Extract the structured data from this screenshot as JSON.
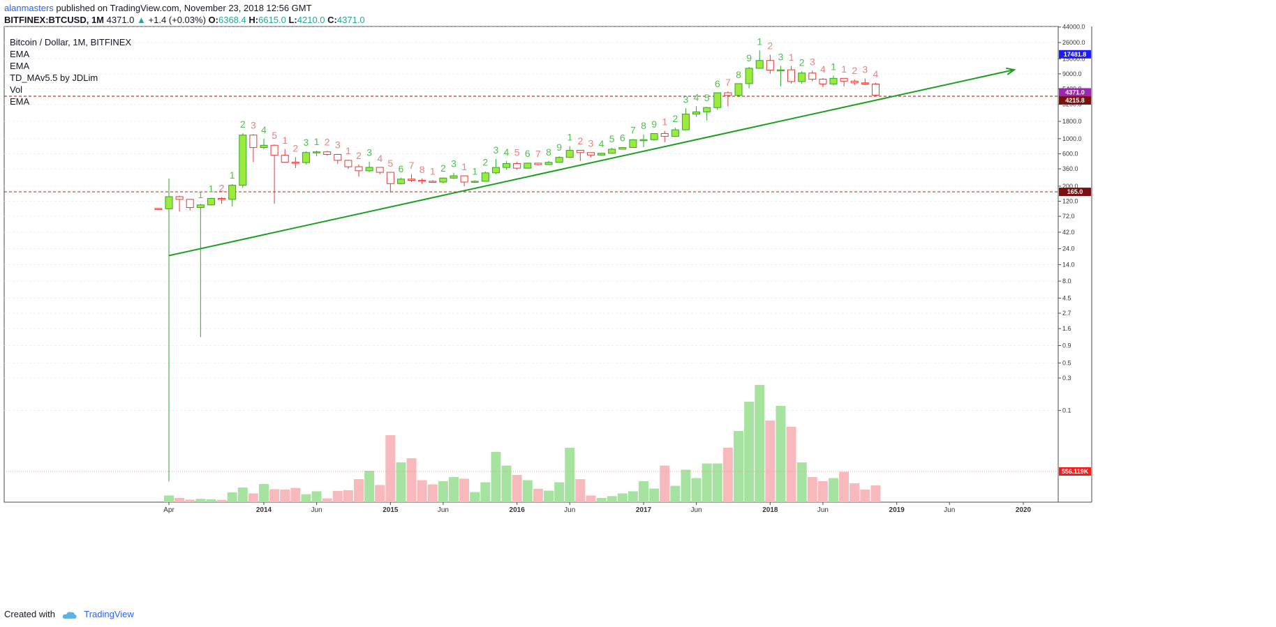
{
  "header": {
    "author": "alanmasters",
    "published_text": " published on TradingView.com, November 23, 2018 12:56 GMT",
    "symbol": "BITFINEX:BTCUSD, 1M",
    "last": "4371.0",
    "change": "+1.4 (+0.03%)",
    "o_label": "O:",
    "o_value": "6368.4",
    "h_label": "H:",
    "h_value": "6615.0",
    "l_label": "L:",
    "l_value": "4210.0",
    "c_label": "C:",
    "c_value": "4371.0"
  },
  "legend": {
    "title": "Bitcoin / Dollar, 1M, BITFINEX",
    "items": [
      "EMA",
      "EMA",
      "TD_MAv5.5 by JDLim",
      "Vol",
      "EMA"
    ]
  },
  "footer": {
    "created_with": "Created with",
    "brand": "TradingView"
  },
  "colors": {
    "up": "#9bea3c",
    "down": "#e53935",
    "vol_up": "#a6e3a1",
    "vol_down": "#f8b9bd",
    "trend": "#1e9e1e",
    "level": "#c0392b",
    "grid": "#e6f2f7"
  },
  "chart_data": {
    "type": "candlestick",
    "y_scale": "log",
    "y_tick_labels": [
      "44000.0",
      "26000.0",
      "15000.0",
      "9000.0",
      "5400.0",
      "3200.0",
      "1800.0",
      "1000.0",
      "600.0",
      "360.0",
      "200.0",
      "120.0",
      "72.0",
      "42.0",
      "24.0",
      "14.0",
      "8.0",
      "4.5",
      "2.7",
      "1.6",
      "0.9",
      "0.5",
      "0.3",
      "0.1"
    ],
    "x_tick_labels": [
      "Apr",
      "2014",
      "Jun",
      "2015",
      "Jun",
      "2016",
      "Jun",
      "2017",
      "Jun",
      "2018",
      "Jun",
      "2019",
      "Jun",
      "2020"
    ],
    "price_badges": [
      {
        "text": "17481.8",
        "color": "#1c1cff"
      },
      {
        "text": "4371.0",
        "color": "#9c27b0"
      },
      {
        "text": "4215.8",
        "color": "#7b1010"
      },
      {
        "text": "165.0",
        "color": "#7b1010"
      },
      {
        "text": "556.119K",
        "color": "#ff1a1a"
      }
    ],
    "horizontal_levels": [
      4215.8,
      165.0
    ],
    "trendline": {
      "from": {
        "date": "2013-04",
        "price": 19
      },
      "to": {
        "date": "2020-01",
        "price": 12500
      }
    },
    "series": [
      {
        "date": "2013-03",
        "open": 94,
        "high": 95,
        "low": 90,
        "close": 93,
        "td": "",
        "vol": 0
      },
      {
        "date": "2013-04",
        "open": 93,
        "high": 260,
        "low": 0.009,
        "close": 140,
        "td": "",
        "vol": 0.32
      },
      {
        "date": "2013-05",
        "open": 140,
        "high": 145,
        "low": 85,
        "close": 128,
        "td": "",
        "vol": 0.2
      },
      {
        "date": "2013-06",
        "open": 128,
        "high": 129,
        "low": 88,
        "close": 97,
        "td": "",
        "vol": 0.12
      },
      {
        "date": "2013-07",
        "open": 97,
        "high": 110,
        "low": 1.2,
        "close": 106,
        "td": "1",
        "vol": 0.16
      },
      {
        "date": "2013-08",
        "open": 106,
        "high": 135,
        "low": 104,
        "close": 132,
        "td": "1",
        "vol": 0.14
      },
      {
        "date": "2013-09",
        "open": 132,
        "high": 138,
        "low": 110,
        "close": 128,
        "td": "2",
        "vol": 0.11
      },
      {
        "date": "2013-10",
        "open": 128,
        "high": 215,
        "low": 100,
        "close": 206,
        "td": "1",
        "vol": 0.47
      },
      {
        "date": "2013-11",
        "open": 206,
        "high": 1200,
        "low": 190,
        "close": 1130,
        "td": "2",
        "vol": 0.7
      },
      {
        "date": "2013-12",
        "open": 1130,
        "high": 1165,
        "low": 450,
        "close": 740,
        "td": "3",
        "vol": 0.42
      },
      {
        "date": "2014-01",
        "open": 740,
        "high": 1000,
        "low": 700,
        "close": 800,
        "td": "4",
        "vol": 0.87
      },
      {
        "date": "2014-02",
        "open": 800,
        "high": 820,
        "low": 110,
        "close": 570,
        "td": "5",
        "vol": 0.62
      },
      {
        "date": "2014-03",
        "open": 570,
        "high": 700,
        "low": 450,
        "close": 450,
        "td": "1",
        "vol": 0.6
      },
      {
        "date": "2014-04",
        "open": 450,
        "high": 535,
        "low": 370,
        "close": 445,
        "td": "2",
        "vol": 0.68
      },
      {
        "date": "2014-05",
        "open": 445,
        "high": 650,
        "low": 420,
        "close": 625,
        "td": "3",
        "vol": 0.38
      },
      {
        "date": "2014-06",
        "open": 625,
        "high": 670,
        "low": 550,
        "close": 640,
        "td": "1",
        "vol": 0.52
      },
      {
        "date": "2014-07",
        "open": 640,
        "high": 660,
        "low": 565,
        "close": 585,
        "td": "2",
        "vol": 0.18
      },
      {
        "date": "2014-08",
        "open": 585,
        "high": 600,
        "low": 425,
        "close": 480,
        "td": "3",
        "vol": 0.54
      },
      {
        "date": "2014-09",
        "open": 480,
        "high": 490,
        "low": 360,
        "close": 386,
        "td": "1",
        "vol": 0.57
      },
      {
        "date": "2014-10",
        "open": 386,
        "high": 415,
        "low": 275,
        "close": 337,
        "td": "2",
        "vol": 1.1
      },
      {
        "date": "2014-11",
        "open": 337,
        "high": 460,
        "low": 323,
        "close": 378,
        "td": "3",
        "vol": 1.5
      },
      {
        "date": "2014-12",
        "open": 378,
        "high": 380,
        "low": 300,
        "close": 320,
        "td": "4",
        "vol": 0.82
      },
      {
        "date": "2015-01",
        "open": 320,
        "high": 320,
        "low": 160,
        "close": 218,
        "td": "5",
        "vol": 3.2
      },
      {
        "date": "2015-02",
        "open": 218,
        "high": 265,
        "low": 213,
        "close": 254,
        "td": "6",
        "vol": 1.9
      },
      {
        "date": "2015-03",
        "open": 254,
        "high": 300,
        "low": 230,
        "close": 244,
        "td": "7",
        "vol": 2.1
      },
      {
        "date": "2015-04",
        "open": 244,
        "high": 260,
        "low": 215,
        "close": 236,
        "td": "8",
        "vol": 1.05
      },
      {
        "date": "2015-05",
        "open": 236,
        "high": 245,
        "low": 226,
        "close": 230,
        "td": "1",
        "vol": 0.85
      },
      {
        "date": "2015-06",
        "open": 230,
        "high": 270,
        "low": 220,
        "close": 263,
        "td": "2",
        "vol": 1.0
      },
      {
        "date": "2015-07",
        "open": 263,
        "high": 315,
        "low": 255,
        "close": 284,
        "td": "3",
        "vol": 1.2
      },
      {
        "date": "2015-08",
        "open": 284,
        "high": 285,
        "low": 200,
        "close": 230,
        "td": "1",
        "vol": 1.12
      },
      {
        "date": "2015-09",
        "open": 230,
        "high": 245,
        "low": 225,
        "close": 236,
        "td": "1",
        "vol": 0.48
      },
      {
        "date": "2015-10",
        "open": 236,
        "high": 330,
        "low": 233,
        "close": 314,
        "td": "2",
        "vol": 0.95
      },
      {
        "date": "2015-11",
        "open": 314,
        "high": 500,
        "low": 300,
        "close": 377,
        "td": "3",
        "vol": 2.4
      },
      {
        "date": "2015-12",
        "open": 377,
        "high": 465,
        "low": 350,
        "close": 431,
        "td": "4",
        "vol": 1.75
      },
      {
        "date": "2016-01",
        "open": 431,
        "high": 460,
        "low": 350,
        "close": 368,
        "td": "5",
        "vol": 1.3
      },
      {
        "date": "2016-02",
        "open": 368,
        "high": 445,
        "low": 365,
        "close": 436,
        "td": "6",
        "vol": 1.05
      },
      {
        "date": "2016-03",
        "open": 436,
        "high": 440,
        "low": 405,
        "close": 416,
        "td": "7",
        "vol": 0.64
      },
      {
        "date": "2016-04",
        "open": 416,
        "high": 470,
        "low": 412,
        "close": 448,
        "td": "8",
        "vol": 0.55
      },
      {
        "date": "2016-05",
        "open": 448,
        "high": 550,
        "low": 440,
        "close": 531,
        "td": "9",
        "vol": 0.95
      },
      {
        "date": "2016-06",
        "open": 531,
        "high": 780,
        "low": 520,
        "close": 674,
        "td": "1",
        "vol": 2.6
      },
      {
        "date": "2016-07",
        "open": 674,
        "high": 680,
        "low": 470,
        "close": 624,
        "td": "2",
        "vol": 1.1
      },
      {
        "date": "2016-08",
        "open": 624,
        "high": 625,
        "low": 530,
        "close": 575,
        "td": "3",
        "vol": 0.32
      },
      {
        "date": "2016-09",
        "open": 575,
        "high": 620,
        "low": 560,
        "close": 610,
        "td": "4",
        "vol": 0.2
      },
      {
        "date": "2016-10",
        "open": 610,
        "high": 730,
        "low": 600,
        "close": 700,
        "td": "5",
        "vol": 0.29
      },
      {
        "date": "2016-11",
        "open": 700,
        "high": 755,
        "low": 690,
        "close": 742,
        "td": "6",
        "vol": 0.42
      },
      {
        "date": "2016-12",
        "open": 742,
        "high": 980,
        "low": 740,
        "close": 963,
        "td": "7",
        "vol": 0.52
      },
      {
        "date": "2017-01",
        "open": 963,
        "high": 1150,
        "low": 750,
        "close": 966,
        "td": "8",
        "vol": 1.0
      },
      {
        "date": "2017-02",
        "open": 966,
        "high": 1200,
        "low": 930,
        "close": 1190,
        "td": "9",
        "vol": 0.65
      },
      {
        "date": "2017-03",
        "open": 1190,
        "high": 1300,
        "low": 890,
        "close": 1080,
        "td": "1",
        "vol": 1.75
      },
      {
        "date": "2017-04",
        "open": 1080,
        "high": 1450,
        "low": 1070,
        "close": 1350,
        "td": "2",
        "vol": 0.78
      },
      {
        "date": "2017-05",
        "open": 1350,
        "high": 2800,
        "low": 1350,
        "close": 2300,
        "td": "3",
        "vol": 1.55
      },
      {
        "date": "2017-06",
        "open": 2300,
        "high": 3000,
        "low": 2100,
        "close": 2480,
        "td": "4",
        "vol": 1.15
      },
      {
        "date": "2017-07",
        "open": 2480,
        "high": 2950,
        "low": 1850,
        "close": 2870,
        "td": "5",
        "vol": 1.85
      },
      {
        "date": "2017-08",
        "open": 2870,
        "high": 4750,
        "low": 2650,
        "close": 4740,
        "td": "6",
        "vol": 1.85
      },
      {
        "date": "2017-09",
        "open": 4740,
        "high": 4970,
        "low": 2980,
        "close": 4330,
        "td": "7",
        "vol": 2.6
      },
      {
        "date": "2017-10",
        "open": 4330,
        "high": 6480,
        "low": 4100,
        "close": 6460,
        "td": "8",
        "vol": 3.4
      },
      {
        "date": "2017-11",
        "open": 6460,
        "high": 11400,
        "low": 5500,
        "close": 10860,
        "td": "9",
        "vol": 4.8
      },
      {
        "date": "2017-12",
        "open": 10860,
        "high": 19900,
        "low": 10800,
        "close": 14150,
        "td": "1",
        "vol": 5.6
      },
      {
        "date": "2018-01",
        "open": 14150,
        "high": 17180,
        "low": 9000,
        "close": 10200,
        "td": "2",
        "vol": 3.9
      },
      {
        "date": "2018-02",
        "open": 10200,
        "high": 11800,
        "low": 5900,
        "close": 10320,
        "td": "3",
        "vol": 4.6
      },
      {
        "date": "2018-03",
        "open": 10320,
        "high": 11700,
        "low": 6500,
        "close": 6930,
        "td": "1",
        "vol": 3.6
      },
      {
        "date": "2018-04",
        "open": 6930,
        "high": 9800,
        "low": 6430,
        "close": 9240,
        "td": "2",
        "vol": 1.9
      },
      {
        "date": "2018-05",
        "open": 9240,
        "high": 10000,
        "low": 7000,
        "close": 7500,
        "td": "3",
        "vol": 1.2
      },
      {
        "date": "2018-06",
        "open": 7500,
        "high": 7780,
        "low": 5750,
        "close": 6390,
        "td": "4",
        "vol": 1.0
      },
      {
        "date": "2018-07",
        "open": 6390,
        "high": 8490,
        "low": 6070,
        "close": 7730,
        "td": "1",
        "vol": 1.15
      },
      {
        "date": "2018-08",
        "open": 7730,
        "high": 7780,
        "low": 5880,
        "close": 7030,
        "td": "1",
        "vol": 1.45
      },
      {
        "date": "2018-09",
        "open": 7030,
        "high": 7420,
        "low": 6110,
        "close": 6630,
        "td": "2",
        "vol": 0.9
      },
      {
        "date": "2018-10",
        "open": 6630,
        "high": 7680,
        "low": 6200,
        "close": 6370,
        "td": "3",
        "vol": 0.6
      },
      {
        "date": "2018-11",
        "open": 6370,
        "high": 6615,
        "low": 4210,
        "close": 4371,
        "td": "4",
        "vol": 0.8
      }
    ]
  }
}
